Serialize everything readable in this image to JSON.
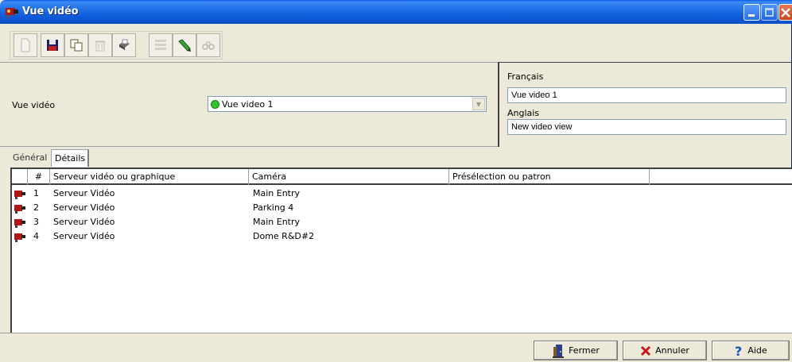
{
  "window": {
    "title": "Vue vidéo",
    "icons": [
      "app-camera-icon",
      "minimize-icon",
      "maximize-icon",
      "close-icon"
    ]
  },
  "toolbar": {
    "buttons": [
      {
        "name": "new-button",
        "icon": "new-document-icon",
        "enabled": false
      },
      {
        "name": "save-button",
        "icon": "floppy-disk-icon",
        "enabled": true
      },
      {
        "name": "copy-button",
        "icon": "copy-icon",
        "enabled": true
      },
      {
        "name": "delete-button",
        "icon": "trash-icon",
        "enabled": false
      },
      {
        "name": "print-button",
        "icon": "printer-icon",
        "enabled": true
      },
      {
        "name": "list-button",
        "icon": "list-icon",
        "enabled": false
      },
      {
        "name": "edit-button",
        "icon": "pencil-icon",
        "enabled": true
      },
      {
        "name": "find-button",
        "icon": "binoculars-icon",
        "enabled": false
      }
    ]
  },
  "form": {
    "vue_label": "Vue vidéo",
    "vue_selected": "Vue video 1",
    "status_color": "#2ec52e"
  },
  "lang": {
    "french_label": "Français",
    "french_value": "Vue video 1",
    "english_label": "Anglais",
    "english_value": "New video view"
  },
  "tabs": {
    "general": "Général",
    "details": "Détails",
    "active": "Détails"
  },
  "grid": {
    "columns": [
      "#",
      "Serveur vidéo ou graphique",
      "Caméra",
      "Présélection ou patron"
    ],
    "rows": [
      {
        "num": "1",
        "server": "Serveur Vidéo",
        "camera": "Main Entry",
        "preset": ""
      },
      {
        "num": "2",
        "server": "Serveur Vidéo",
        "camera": "Parking 4",
        "preset": ""
      },
      {
        "num": "3",
        "server": "Serveur Vidéo",
        "camera": "Main Entry",
        "preset": ""
      },
      {
        "num": "4",
        "server": "Serveur Vidéo",
        "camera": "Dome R&D#2",
        "preset": ""
      }
    ]
  },
  "footer": {
    "close_label": "Fermer",
    "cancel_label": "Annuler",
    "help_label": "Aide"
  },
  "colors": {
    "title_bar": "#0e5bd8",
    "window_bg": "#ece9d8",
    "close_red": "#c8451c"
  }
}
